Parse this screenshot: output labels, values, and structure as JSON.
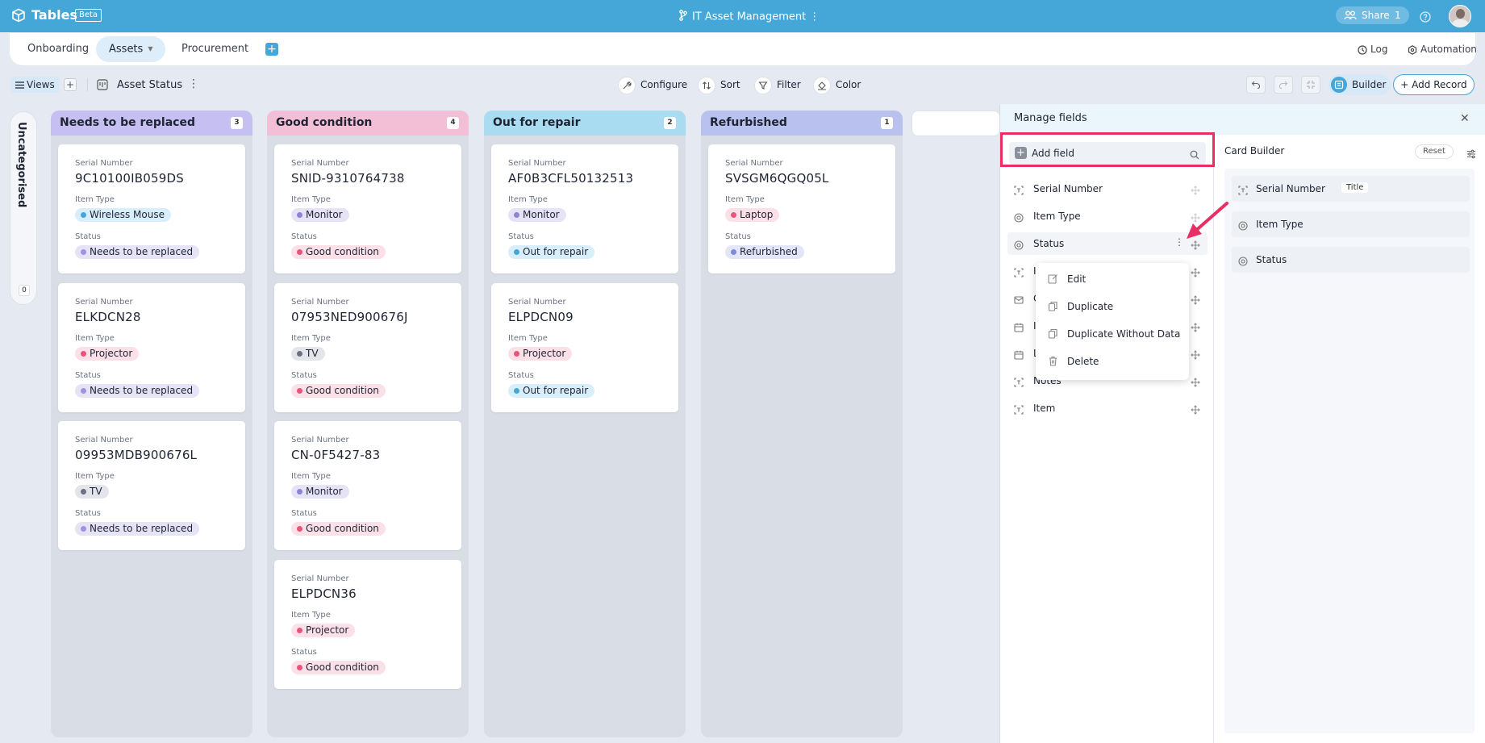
{
  "app": {
    "name": "Tables",
    "badge": "Beta",
    "document_title": "IT Asset Management",
    "share_label": "Share",
    "share_count": "1"
  },
  "tabs": [
    {
      "label": "Onboarding"
    },
    {
      "label": "Assets"
    },
    {
      "label": "Procurement"
    }
  ],
  "tab_add": "+",
  "header_right": {
    "log": "Log",
    "automation": "Automation"
  },
  "toolbar": {
    "views_label": "Views",
    "view_add": "+",
    "view_name": "Asset Status",
    "configure": "Configure",
    "sort": "Sort",
    "filter": "Filter",
    "color": "Color",
    "builder": "Builder",
    "add_record": "+ Add Record"
  },
  "uncategorised": {
    "label": "Uncategorised",
    "count": "0"
  },
  "columns": [
    {
      "title": "Needs to be replaced",
      "count": "3",
      "color": "#c6bff2",
      "cards": [
        {
          "serial": "9C10100IB059DS",
          "item_type": "Wireless Mouse",
          "status": "Needs to be replaced"
        },
        {
          "serial": "ELKDCN28",
          "item_type": "Projector",
          "status": "Needs to be replaced"
        },
        {
          "serial": "09953MDB900676L",
          "item_type": "TV",
          "status": "Needs to be replaced"
        }
      ]
    },
    {
      "title": "Good condition",
      "count": "4",
      "color": "#f3bfd6",
      "cards": [
        {
          "serial": "SNID-9310764738",
          "item_type": "Monitor",
          "status": "Good condition"
        },
        {
          "serial": "07953NED900676J",
          "item_type": "TV",
          "status": "Good condition"
        },
        {
          "serial": "CN-0F5427-83",
          "item_type": "Monitor",
          "status": "Good condition"
        },
        {
          "serial": "ELPDCN36",
          "item_type": "Projector",
          "status": "Good condition"
        }
      ]
    },
    {
      "title": "Out for repair",
      "count": "2",
      "color": "#a9dcf0",
      "cards": [
        {
          "serial": "AF0B3CFL50132513",
          "item_type": "Monitor",
          "status": "Out for repair"
        },
        {
          "serial": "ELPDCN09",
          "item_type": "Projector",
          "status": "Out for repair"
        }
      ]
    },
    {
      "title": "Refurbished",
      "count": "1",
      "color": "#b9c2ee",
      "cards": [
        {
          "serial": "SVSGM6QGQ05L",
          "item_type": "Laptop",
          "status": "Refurbished"
        }
      ]
    }
  ],
  "card_labels": {
    "serial": "Serial Number",
    "item_type": "Item Type",
    "status": "Status"
  },
  "pill_colors": {
    "Wireless Mouse": {
      "bg": "#d8eefa",
      "dot": "#45a7d8"
    },
    "Projector": {
      "bg": "#fbe0e8",
      "dot": "#e8557a"
    },
    "TV": {
      "bg": "#e3e5ea",
      "dot": "#6b7280"
    },
    "Monitor": {
      "bg": "#e6e3f7",
      "dot": "#8e84d6"
    },
    "Laptop": {
      "bg": "#fbe0e8",
      "dot": "#e8557a"
    },
    "Needs to be replaced": {
      "bg": "#e6e3f7",
      "dot": "#9d93e0"
    },
    "Good condition": {
      "bg": "#fbe0e8",
      "dot": "#e8557a"
    },
    "Out for repair": {
      "bg": "#d8eefa",
      "dot": "#45a7d8"
    },
    "Refurbished": {
      "bg": "#e2e6f8",
      "dot": "#7d8bd6"
    }
  },
  "manage_fields": {
    "title": "Manage fields",
    "add_field": "Add field",
    "fields": [
      {
        "label": "Serial Number",
        "icon": "text-field-icon"
      },
      {
        "label": "Item Type",
        "icon": "select-field-icon"
      },
      {
        "label": "Status",
        "icon": "select-field-icon"
      },
      {
        "label": "Is",
        "icon": "text-field-icon"
      },
      {
        "label": "C",
        "icon": "email-field-icon"
      },
      {
        "label": "Is",
        "icon": "date-field-icon"
      },
      {
        "label": "L",
        "icon": "date-field-icon"
      },
      {
        "label": "Notes",
        "icon": "text-field-icon"
      },
      {
        "label": "Item",
        "icon": "text-field-icon"
      }
    ],
    "context_menu": [
      "Edit",
      "Duplicate",
      "Duplicate Without Data",
      "Delete"
    ]
  },
  "card_builder": {
    "title": "Card Builder",
    "reset": "Reset",
    "items": [
      {
        "label": "Serial Number",
        "tag": "Title"
      },
      {
        "label": "Item Type",
        "tag": ""
      },
      {
        "label": "Status",
        "tag": ""
      }
    ]
  },
  "colors": {
    "accent": "#45a7d8",
    "highlight": "#ea2e64"
  }
}
